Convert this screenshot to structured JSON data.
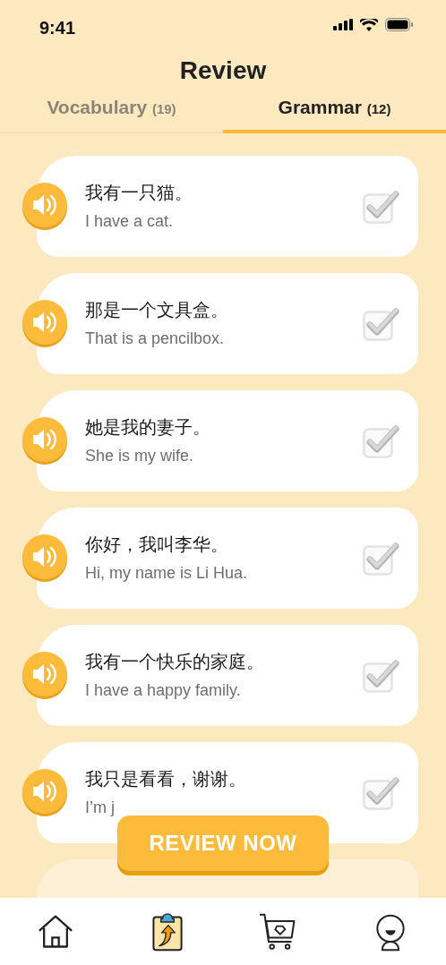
{
  "status_bar": {
    "time": "9:41"
  },
  "title": "Review",
  "tabs": [
    {
      "label": "Vocabulary",
      "count": "(19)",
      "selected": false
    },
    {
      "label": "Grammar",
      "count": "(12)",
      "selected": true
    }
  ],
  "sentences": [
    {
      "chinese": "我有一只猫。",
      "english": "I have a cat.",
      "checked": true
    },
    {
      "chinese": "那是一个文具盒。",
      "english": "That is a pencilbox.",
      "checked": true
    },
    {
      "chinese": "她是我的妻子。",
      "english": "She is my wife.",
      "checked": true
    },
    {
      "chinese": "你好，我叫李华。",
      "english": "Hi, my name is Li Hua.",
      "checked": true
    },
    {
      "chinese": "我有一个快乐的家庭。",
      "english": "I have a happy family.",
      "checked": true
    },
    {
      "chinese": "我只是看看，谢谢。",
      "english": "I’m j",
      "checked": true
    }
  ],
  "review_button": "REVIEW NOW",
  "nav": [
    {
      "kind": "home",
      "selected": false
    },
    {
      "kind": "review",
      "selected": true
    },
    {
      "kind": "shop",
      "selected": false
    },
    {
      "kind": "profile",
      "selected": false
    }
  ]
}
